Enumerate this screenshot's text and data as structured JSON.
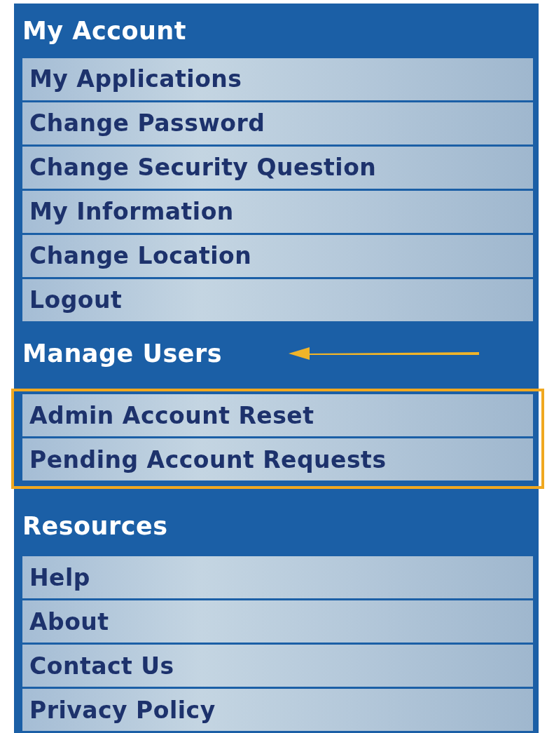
{
  "sections": [
    {
      "title": "My Account",
      "highlighted": false,
      "annotated": false,
      "items": [
        "My Applications",
        "Change Password",
        "Change Security Question",
        "My Information",
        "Change Location",
        "Logout"
      ]
    },
    {
      "title": "Manage Users",
      "highlighted": true,
      "annotated": true,
      "items": [
        "Admin Account Reset",
        "Pending Account Requests"
      ]
    },
    {
      "title": "Resources",
      "highlighted": false,
      "annotated": false,
      "items": [
        "Help",
        "About",
        "Contact Us",
        "Privacy Policy"
      ]
    }
  ]
}
